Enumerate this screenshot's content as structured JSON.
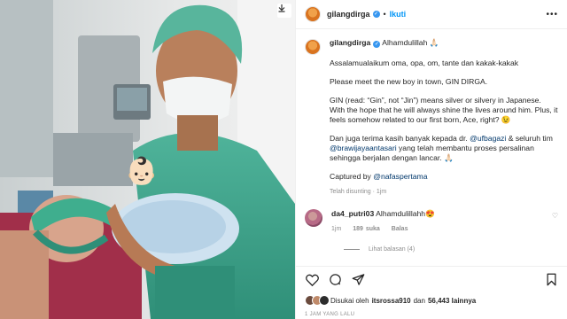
{
  "post": {
    "username": "gilangdirga",
    "dot": "•",
    "follow_label": "Ikuti",
    "more_icon": "more-icon",
    "baby_emoji": "👶🏻"
  },
  "caption": {
    "username": "gilangdirga",
    "first_line": "Alhamdulillah 🙏🏻",
    "paragraphs": {
      "p1": "Assalamualaikum oma, opa, om, tante dan kakak-kakak",
      "p2": "Please meet the new boy in town, GIN DIRGA.",
      "p3": "GIN (read: “Gin”, not “Jin”) means silver or silvery in Japanese. With the hope that he will always shine the lives around him. Plus, it feels somehow related to our first born, Ace, right? 😉",
      "p4_a": "Dan juga terima kasih banyak kepada dr. ",
      "p4_m1": "@ufbagazi",
      "p4_b": " & seluruh tim ",
      "p4_m2": "@brawijayaantasari",
      "p4_c": " yang telah membantu proses persalinan sehingga berjalan dengan lancar. 🙏🏻",
      "p5_a": "Captured by ",
      "p5_m": "@nafaspertama"
    },
    "edited": "Telah disunting · 1jm"
  },
  "comment": {
    "username": "da4_putri03",
    "text": "Alhamdulillahh😍",
    "time": "1jm",
    "likes": "189 suka",
    "reply": "Balas",
    "view_replies": "Lihat balasan (4)"
  },
  "likes": {
    "prefix": "Disukai oleh",
    "user": "itsrossa910",
    "and": "dan",
    "count": "56,443 lainnya"
  },
  "time_ago": "1 JAM YANG LALU",
  "colors": {
    "link": "#0095f6",
    "mention": "#00376b",
    "muted": "#8e8e8e"
  }
}
